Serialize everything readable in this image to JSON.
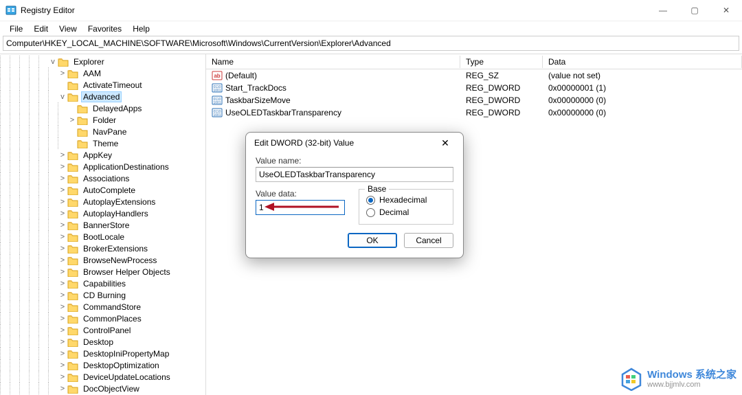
{
  "window": {
    "title": "Registry Editor",
    "controls": {
      "minimize": "—",
      "maximize": "▢",
      "close": "✕"
    }
  },
  "menubar": [
    "File",
    "Edit",
    "View",
    "Favorites",
    "Help"
  ],
  "path": "Computer\\HKEY_LOCAL_MACHINE\\SOFTWARE\\Microsoft\\Windows\\CurrentVersion\\Explorer\\Advanced",
  "tree": [
    {
      "indent": 5,
      "expander": "v",
      "label": "Explorer",
      "selected": false
    },
    {
      "indent": 6,
      "expander": ">",
      "label": "AAM"
    },
    {
      "indent": 6,
      "expander": "",
      "label": "ActivateTimeout"
    },
    {
      "indent": 6,
      "expander": "v",
      "label": "Advanced",
      "selected": true
    },
    {
      "indent": 7,
      "expander": "",
      "label": "DelayedApps"
    },
    {
      "indent": 7,
      "expander": ">",
      "label": "Folder"
    },
    {
      "indent": 7,
      "expander": "",
      "label": "NavPane"
    },
    {
      "indent": 7,
      "expander": "",
      "label": "Theme"
    },
    {
      "indent": 6,
      "expander": ">",
      "label": "AppKey"
    },
    {
      "indent": 6,
      "expander": ">",
      "label": "ApplicationDestinations"
    },
    {
      "indent": 6,
      "expander": ">",
      "label": "Associations"
    },
    {
      "indent": 6,
      "expander": ">",
      "label": "AutoComplete"
    },
    {
      "indent": 6,
      "expander": ">",
      "label": "AutoplayExtensions"
    },
    {
      "indent": 6,
      "expander": ">",
      "label": "AutoplayHandlers"
    },
    {
      "indent": 6,
      "expander": ">",
      "label": "BannerStore"
    },
    {
      "indent": 6,
      "expander": ">",
      "label": "BootLocale"
    },
    {
      "indent": 6,
      "expander": ">",
      "label": "BrokerExtensions"
    },
    {
      "indent": 6,
      "expander": ">",
      "label": "BrowseNewProcess"
    },
    {
      "indent": 6,
      "expander": ">",
      "label": "Browser Helper Objects"
    },
    {
      "indent": 6,
      "expander": ">",
      "label": "Capabilities"
    },
    {
      "indent": 6,
      "expander": ">",
      "label": "CD Burning"
    },
    {
      "indent": 6,
      "expander": ">",
      "label": "CommandStore"
    },
    {
      "indent": 6,
      "expander": ">",
      "label": "CommonPlaces"
    },
    {
      "indent": 6,
      "expander": ">",
      "label": "ControlPanel"
    },
    {
      "indent": 6,
      "expander": ">",
      "label": "Desktop"
    },
    {
      "indent": 6,
      "expander": ">",
      "label": "DesktopIniPropertyMap"
    },
    {
      "indent": 6,
      "expander": ">",
      "label": "DesktopOptimization"
    },
    {
      "indent": 6,
      "expander": ">",
      "label": "DeviceUpdateLocations"
    },
    {
      "indent": 6,
      "expander": ">",
      "label": "DocObjectView"
    }
  ],
  "columns": {
    "name": "Name",
    "type": "Type",
    "data": "Data"
  },
  "values": [
    {
      "icon": "sz",
      "name": "(Default)",
      "type": "REG_SZ",
      "data": "(value not set)"
    },
    {
      "icon": "bin",
      "name": "Start_TrackDocs",
      "type": "REG_DWORD",
      "data": "0x00000001 (1)"
    },
    {
      "icon": "bin",
      "name": "TaskbarSizeMove",
      "type": "REG_DWORD",
      "data": "0x00000000 (0)"
    },
    {
      "icon": "bin",
      "name": "UseOLEDTaskbarTransparency",
      "type": "REG_DWORD",
      "data": "0x00000000 (0)"
    }
  ],
  "dialog": {
    "title": "Edit DWORD (32-bit) Value",
    "valueNameLabel": "Value name:",
    "valueName": "UseOLEDTaskbarTransparency",
    "valueDataLabel": "Value data:",
    "valueData": "1",
    "baseLabel": "Base",
    "radioHex": "Hexadecimal",
    "radioDec": "Decimal",
    "baseSelected": "hex",
    "ok": "OK",
    "cancel": "Cancel"
  },
  "watermark": {
    "line1": "Windows 系统之家",
    "line2": "www.bjjmlv.com"
  }
}
